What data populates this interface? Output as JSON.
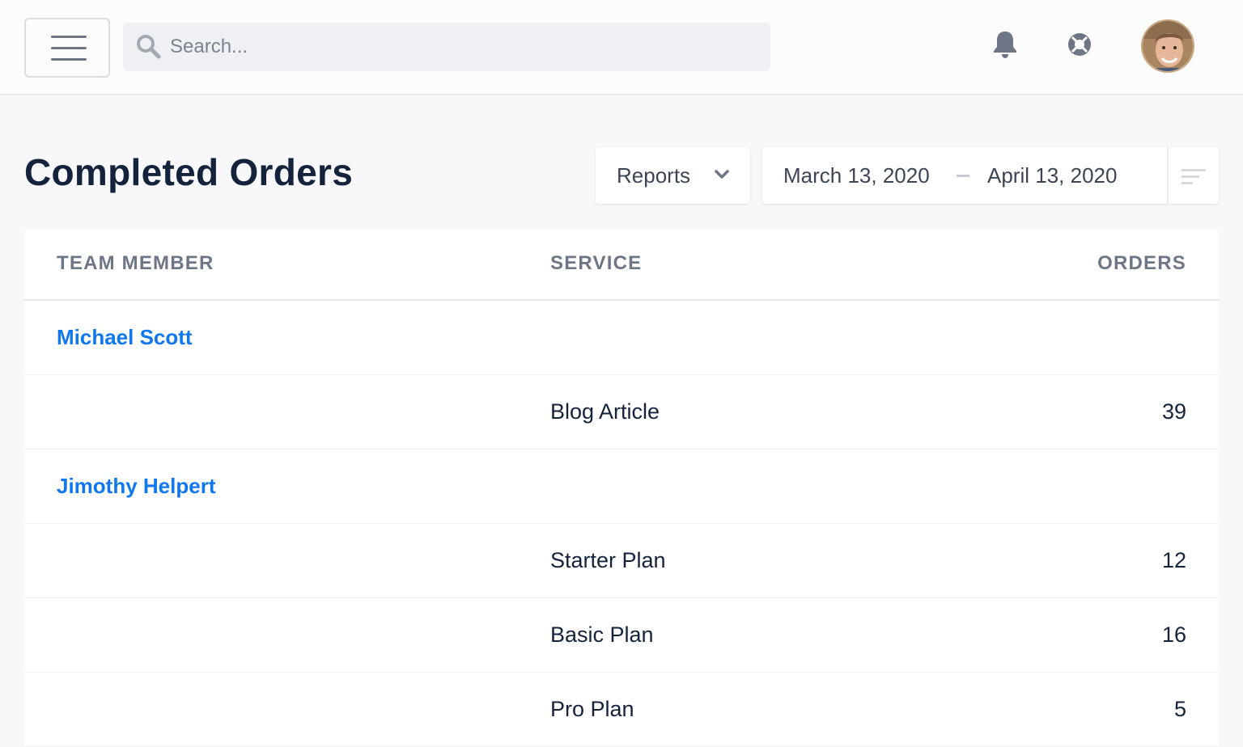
{
  "topbar": {
    "search_placeholder": "Search..."
  },
  "page": {
    "title": "Completed Orders"
  },
  "reports_dropdown": {
    "label": "Reports"
  },
  "date_range": {
    "start": "March 13, 2020",
    "end": "April 13, 2020"
  },
  "table": {
    "headers": {
      "member": "TEAM MEMBER",
      "service": "SERVICE",
      "orders": "ORDERS"
    },
    "rows": [
      {
        "member": "Michael Scott",
        "service": "",
        "orders": ""
      },
      {
        "member": "",
        "service": "Blog Article",
        "orders": "39"
      },
      {
        "member": "Jimothy Helpert",
        "service": "",
        "orders": ""
      },
      {
        "member": "",
        "service": "Starter Plan",
        "orders": "12"
      },
      {
        "member": "",
        "service": "Basic Plan",
        "orders": "16"
      },
      {
        "member": "",
        "service": "Pro Plan",
        "orders": "5"
      }
    ]
  },
  "colors": {
    "accent_link": "#0f78f0",
    "title_text": "#14233c",
    "header_text": "#6d7686"
  },
  "icons": [
    "menu-icon",
    "search-icon",
    "bell-icon",
    "help-icon",
    "chevron-down-icon",
    "filter-icon"
  ]
}
